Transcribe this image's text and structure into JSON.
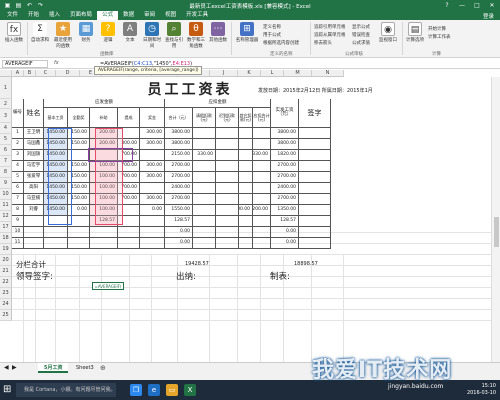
{
  "window": {
    "title": "最新员工excel工资表模板.xls [兼容模式] - Excel",
    "controls": [
      "?",
      "—",
      "□",
      "✕"
    ]
  },
  "ribbon_tabs": [
    "文件",
    "开始",
    "插入",
    "页面布局",
    "公式",
    "数据",
    "审阅",
    "视图",
    "开发工具"
  ],
  "active_tab": "公式",
  "login": "登录",
  "ribbon": {
    "insert_function": "插入函数",
    "autosum": "自动求和",
    "recent": "最近使用的函数",
    "financial": "财务",
    "logical": "逻辑",
    "text": "文本",
    "datetime": "日期和时间",
    "lookup": "查找与引用",
    "math": "数学和三角函数",
    "other": "其他函数",
    "library_group": "函数库",
    "name_manager": "名称管理器",
    "define_name": "定义名称",
    "use_in_formula": "用于公式",
    "create_from_sel": "根据所选内容创建",
    "names_group": "定义的名称",
    "trace_precedents": "追踪引用单元格",
    "trace_dependents": "追踪从属单元格",
    "remove_arrows": "移去箭头",
    "show_formulas": "显示公式",
    "error_check": "错误检查",
    "evaluate": "公式求值",
    "watch": "监视窗口",
    "audit_group": "公式审核",
    "calc_options": "计算选项",
    "calc_now": "开始计算",
    "calc_sheet": "计算工作表",
    "calc_group": "计算"
  },
  "formula_bar": {
    "name_box": "AVERAGEIF",
    "fx": "fx",
    "formula_prefix": "=AVERAGEIF(",
    "range1": "C4:C13",
    "mid": ",\"1450\",",
    "range2": "E4:E13",
    "suffix": ")",
    "tooltip": "AVERAGEIF(range, criteria, [average_range])"
  },
  "columns": [
    "A",
    "B",
    "C",
    "D",
    "E",
    "F",
    "G",
    "H",
    "I",
    "J",
    "K",
    "L",
    "M",
    "N"
  ],
  "rows": [
    "1",
    "2",
    "3",
    "4",
    "5",
    "6",
    "7",
    "8",
    "9",
    "10",
    "11",
    "12",
    "17",
    "18",
    "19",
    "20",
    "21",
    "22",
    "23",
    "24",
    "25"
  ],
  "sheet": {
    "title": "员工工资表",
    "issue_date": "发放日期：2015年2月12日 所属日期：2015年1月",
    "h_no": "编号",
    "h_name": "姓名",
    "h_should": "应发金额",
    "h_deduct": "应扣金额",
    "h_actual": "实发工资（元）",
    "h_sign": "签字",
    "sub_headers": [
      "基本工资",
      "全勤奖",
      "补助",
      "提成",
      "奖金",
      "合计（元）",
      "请假扣款(元)",
      "迟到扣款(元)",
      "其它扣款(元)",
      "应扣合计(元)"
    ],
    "rows": [
      {
        "no": "1",
        "name": "王卫明",
        "c": [
          "1450.00",
          "150.00",
          "200.00",
          "",
          "300.00",
          "3800.00",
          "",
          "",
          "",
          "",
          "3800.00"
        ]
      },
      {
        "no": "2",
        "name": "马国鑫",
        "c": [
          "1450.00",
          "150.00",
          "200.00",
          "300.00",
          "300.00",
          "3800.00",
          "",
          "",
          "",
          "",
          "3800.00"
        ]
      },
      {
        "no": "3",
        "name": "刘国旗",
        "c": [
          "1450.00",
          "",
          "",
          "700.00",
          "",
          "2150.00",
          "330.00",
          "",
          "",
          "330.00",
          "1820.00"
        ]
      },
      {
        "no": "4",
        "name": "马宏宇",
        "c": [
          "1450.00",
          "150.00",
          "100.00",
          "700.00",
          "300.00",
          "2700.00",
          "",
          "",
          "",
          "",
          "2700.00"
        ]
      },
      {
        "no": "5",
        "name": "张爱琴",
        "c": [
          "1450.00",
          "150.00",
          "100.00",
          "700.00",
          "300.00",
          "2700.00",
          "",
          "",
          "",
          "",
          "2700.00"
        ]
      },
      {
        "no": "6",
        "name": "高阳",
        "c": [
          "1450.00",
          "150.00",
          "100.00",
          "700.00",
          "",
          "2400.00",
          "",
          "",
          "",
          "",
          "2400.00"
        ]
      },
      {
        "no": "7",
        "name": "马亚楠",
        "c": [
          "1450.00",
          "150.00",
          "100.00",
          "700.00",
          "300.00",
          "2700.00",
          "",
          "",
          "",
          "",
          "2700.00"
        ]
      },
      {
        "no": "8",
        "name": "刘睿",
        "c": [
          "1450.00",
          "0.00",
          "100.00",
          "",
          "0.00",
          "1550.00",
          "",
          "",
          "200.00",
          "200.00",
          "1350.00"
        ]
      },
      {
        "no": "9",
        "name": "",
        "c": [
          "",
          "",
          "128.57",
          "",
          "",
          "128.57",
          "",
          "",
          "",
          "",
          "128.57"
        ]
      },
      {
        "no": "10",
        "name": "",
        "c": [
          "",
          "",
          "",
          "",
          "",
          "0.00",
          "",
          "",
          "",
          "",
          "0.00"
        ]
      },
      {
        "no": "11",
        "name": "",
        "c": [
          "",
          "",
          "",
          "",
          "",
          "0.00",
          "",
          "",
          "",
          "",
          "0.00"
        ]
      }
    ],
    "subtotal_label": "分栏合计",
    "subtotal_total": "19428.57",
    "subtotal_actual": "18898.57",
    "leader_sign": "领导签字:",
    "cashier": "出纳:",
    "maker": "制表:",
    "active_cell_text": "=AVERAGEIF("
  },
  "sheet_tabs": [
    "5月工资",
    "Sheet3"
  ],
  "taskbar": {
    "search": "我是 Cortana，小娜。有问题尽管问我。",
    "time": "15:10",
    "date": "2016-03-10"
  },
  "watermark": "我爱IT技术网",
  "watermark_url": "jingyan.baidu.com"
}
